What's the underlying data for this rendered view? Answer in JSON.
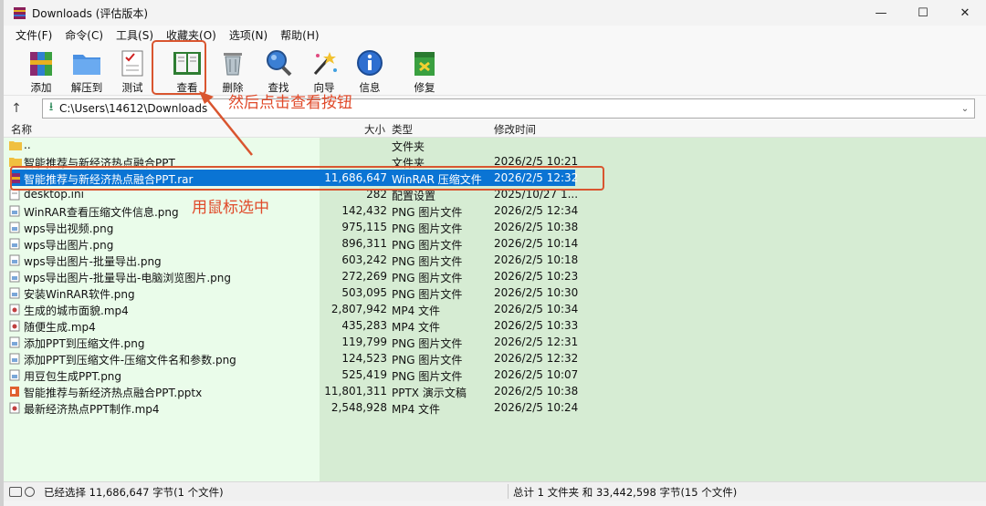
{
  "window": {
    "title": "Downloads (评估版本)"
  },
  "menu": [
    "文件(F)",
    "命令(C)",
    "工具(S)",
    "收藏夹(O)",
    "选项(N)",
    "帮助(H)"
  ],
  "toolbar": [
    {
      "label": "添加",
      "icon": "add-archive-icon"
    },
    {
      "label": "解压到",
      "icon": "extract-folder-icon"
    },
    {
      "label": "测试",
      "icon": "test-checklist-icon"
    },
    {
      "label": "查看",
      "icon": "view-book-icon"
    },
    {
      "label": "删除",
      "icon": "trash-icon"
    },
    {
      "label": "查找",
      "icon": "magnifier-icon"
    },
    {
      "label": "向导",
      "icon": "wizard-wand-icon"
    },
    {
      "label": "信息",
      "icon": "info-icon"
    },
    {
      "label": "修复",
      "icon": "repair-kit-icon"
    }
  ],
  "address": {
    "path": "C:\\Users\\14612\\Downloads"
  },
  "columns": {
    "name": "名称",
    "size": "大小",
    "type": "类型",
    "modified": "修改时间"
  },
  "files": [
    {
      "name": "..",
      "size": "",
      "type": "文件夹",
      "modified": "",
      "icon": "folder"
    },
    {
      "name": "智能推荐与新经济热点融合PPT",
      "size": "",
      "type": "文件夹",
      "modified": "2026/2/5 10:21",
      "icon": "folder"
    },
    {
      "name": "智能推荐与新经济热点融合PPT.rar",
      "size": "11,686,647",
      "type": "WinRAR 压缩文件",
      "modified": "2026/2/5 12:32",
      "icon": "rar",
      "selected": true
    },
    {
      "name": "desktop.ini",
      "size": "282",
      "type": "配置设置",
      "modified": "2025/10/27 1...",
      "icon": "ini"
    },
    {
      "name": "WinRAR查看压缩文件信息.png",
      "size": "142,432",
      "type": "PNG 图片文件",
      "modified": "2026/2/5 12:34",
      "icon": "png"
    },
    {
      "name": "wps导出视频.png",
      "size": "975,115",
      "type": "PNG 图片文件",
      "modified": "2026/2/5 10:38",
      "icon": "png"
    },
    {
      "name": "wps导出图片.png",
      "size": "896,311",
      "type": "PNG 图片文件",
      "modified": "2026/2/5 10:14",
      "icon": "png"
    },
    {
      "name": "wps导出图片-批量导出.png",
      "size": "603,242",
      "type": "PNG 图片文件",
      "modified": "2026/2/5 10:18",
      "icon": "png"
    },
    {
      "name": "wps导出图片-批量导出-电脑浏览图片.png",
      "size": "272,269",
      "type": "PNG 图片文件",
      "modified": "2026/2/5 10:23",
      "icon": "png"
    },
    {
      "name": "安装WinRAR软件.png",
      "size": "503,095",
      "type": "PNG 图片文件",
      "modified": "2026/2/5 10:30",
      "icon": "png"
    },
    {
      "name": "生成的城市面貌.mp4",
      "size": "2,807,942",
      "type": "MP4 文件",
      "modified": "2026/2/5 10:34",
      "icon": "mp4"
    },
    {
      "name": "随便生成.mp4",
      "size": "435,283",
      "type": "MP4 文件",
      "modified": "2026/2/5 10:33",
      "icon": "mp4"
    },
    {
      "name": "添加PPT到压缩文件.png",
      "size": "119,799",
      "type": "PNG 图片文件",
      "modified": "2026/2/5 12:31",
      "icon": "png"
    },
    {
      "name": "添加PPT到压缩文件-压缩文件名和参数.png",
      "size": "124,523",
      "type": "PNG 图片文件",
      "modified": "2026/2/5 12:32",
      "icon": "png"
    },
    {
      "name": "用豆包生成PPT.png",
      "size": "525,419",
      "type": "PNG 图片文件",
      "modified": "2026/2/5 10:07",
      "icon": "png"
    },
    {
      "name": "智能推荐与新经济热点融合PPT.pptx",
      "size": "11,801,311",
      "type": "PPTX 演示文稿",
      "modified": "2026/2/5 10:38",
      "icon": "pptx"
    },
    {
      "name": "最新经济热点PPT制作.mp4",
      "size": "2,548,928",
      "type": "MP4 文件",
      "modified": "2026/2/5 10:24",
      "icon": "mp4"
    }
  ],
  "annotations": {
    "click_view": "然后点击查看按钮",
    "select_with_mouse": "用鼠标选中"
  },
  "status": {
    "left": "已经选择 11,686,647 字节(1 个文件)",
    "right": "总计 1 文件夹 和 33,442,598 字节(15 个文件)"
  },
  "colors": {
    "selection": "#0a74d4",
    "annotation": "#e04a2a",
    "list_bg": "#d6ecd3"
  }
}
